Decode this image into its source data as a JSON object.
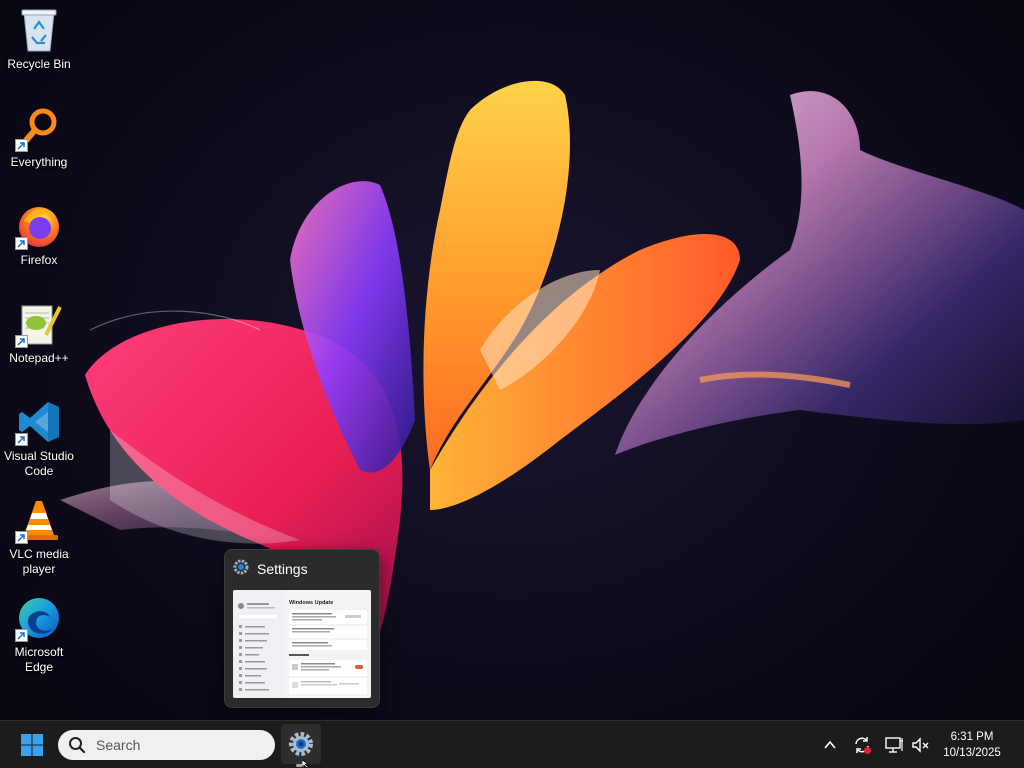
{
  "desktop": {
    "icons": [
      {
        "label": "Recycle Bin",
        "icon": "recycle-bin-icon"
      },
      {
        "label": "Everything",
        "icon": "everything-search-icon"
      },
      {
        "label": "Firefox",
        "icon": "firefox-icon"
      },
      {
        "label": "Notepad++",
        "icon": "notepad-plus-plus-icon"
      },
      {
        "label": "Visual Studio Code",
        "icon": "vscode-icon"
      },
      {
        "label": "VLC media player",
        "icon": "vlc-icon"
      },
      {
        "label": "Microsoft Edge",
        "icon": "edge-icon"
      }
    ]
  },
  "preview": {
    "title": "Settings",
    "thumbnail_heading": "Windows Update"
  },
  "taskbar": {
    "search_placeholder": "Search",
    "pinned_app": "Settings",
    "clock": {
      "time": "6:31 PM",
      "date": "10/13/2025"
    }
  },
  "colors": {
    "taskbar_bg": "#1c1c1c",
    "accent": "#0078d4"
  }
}
